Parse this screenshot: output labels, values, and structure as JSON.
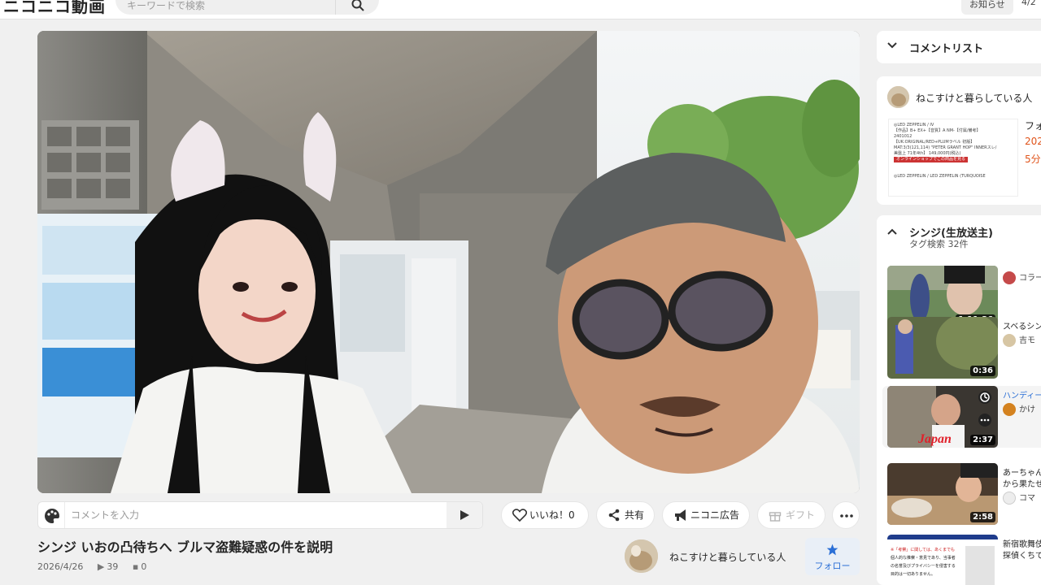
{
  "header": {
    "logo": "ニコニコ動画",
    "search_placeholder": "キーワードで検索",
    "notice_label": "お知らせ",
    "date_partial": "4/2"
  },
  "video": {
    "title": "シンジ いおの凸待ちへ ブルマ盗難疑惑の件を説明",
    "date": "2026/4/26",
    "views": "39",
    "comments": "0"
  },
  "comment_bar": {
    "placeholder": "コメントを入力"
  },
  "actions": {
    "like": "いいね！0",
    "share": "共有",
    "nicoad": "ニコニ広告",
    "gift": "ギフト"
  },
  "owner": {
    "name": "ねこすけと暮らしている人",
    "follow": "フォロー"
  },
  "sidebar": {
    "comment_list": "コメントリスト",
    "ad_card": {
      "owner": "ねこすけと暮らしている人",
      "ad_lines": [
        "◎LED ZEPPELIN / IV",
        "【作品】B+ EX+【音質】A NM-【付属/備考】",
        "2401012",
        "【UK:ORIGINAL/RED+PLUMラベル 初版】",
        "MAT:3/3(121,114) \"PETER GRANT HOP\" INNERスレ/",
        "美盤上 71年4th】 149,000円(税込)",
        "オンラインショップでこの商品を見る",
        "◎LED ZEPPELIN / LED ZEPPELIN (TURQUOISE"
      ],
      "side_title": "フォ",
      "side_date": "202",
      "side_time": "5分"
    },
    "tag_section": {
      "title": "シンジ(生放送主)",
      "subtitle": "タグ検索  32件"
    },
    "related": [
      {
        "duration": "1:11:36",
        "title": "",
        "channel": "コラー"
      },
      {
        "duration": "0:36",
        "title": "スベるシン",
        "channel": "吉モ"
      },
      {
        "duration": "2:37",
        "title": "ハンディー",
        "channel": "かけ",
        "active": true
      },
      {
        "duration": "2:58",
        "title": "あーちゃん",
        "title2": "から果たせ",
        "channel": "コマ"
      },
      {
        "duration": "",
        "title": "新宿歌舞伎",
        "title2": "探偵くちで",
        "channel": ""
      }
    ],
    "thumb5_text": [
      "※「考察」に関しては、あくまでも",
      "個人的な推察・意見であり、当事者",
      "の名誉及びプライバシーを侵害する",
      "目的は一切ありません。"
    ],
    "thumb3_text": "Japan"
  },
  "colors": {
    "accent_blue": "#2b6fd6",
    "page_bg": "#f0f0f0"
  }
}
